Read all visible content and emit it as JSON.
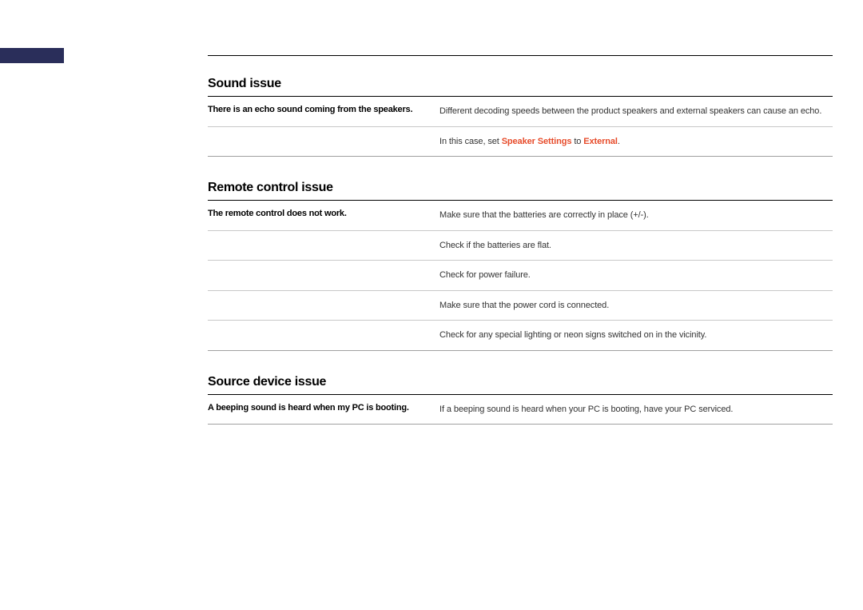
{
  "sections": [
    {
      "title": "Sound issue",
      "rows": [
        {
          "problem": "There is an echo sound coming from the speakers.",
          "solution": "Different decoding speeds between the product speakers and external speakers can cause an echo."
        },
        {
          "problem": "",
          "solution_prefix": "In this case, set ",
          "highlight1": "Speaker Settings",
          "solution_mid": " to ",
          "highlight2": "External",
          "solution_suffix": "."
        }
      ]
    },
    {
      "title": "Remote control issue",
      "rows": [
        {
          "problem": "The remote control does not work.",
          "solution": "Make sure that the batteries are correctly in place (+/-)."
        },
        {
          "problem": "",
          "solution": "Check if the batteries are flat."
        },
        {
          "problem": "",
          "solution": "Check for power failure."
        },
        {
          "problem": "",
          "solution": "Make sure that the power cord is connected."
        },
        {
          "problem": "",
          "solution": "Check for any special lighting or neon signs switched on in the vicinity."
        }
      ]
    },
    {
      "title": "Source device issue",
      "rows": [
        {
          "problem": "A beeping sound is heard when my PC is booting.",
          "solution": "If a beeping sound is heard when your PC is booting, have your PC serviced."
        }
      ]
    }
  ]
}
